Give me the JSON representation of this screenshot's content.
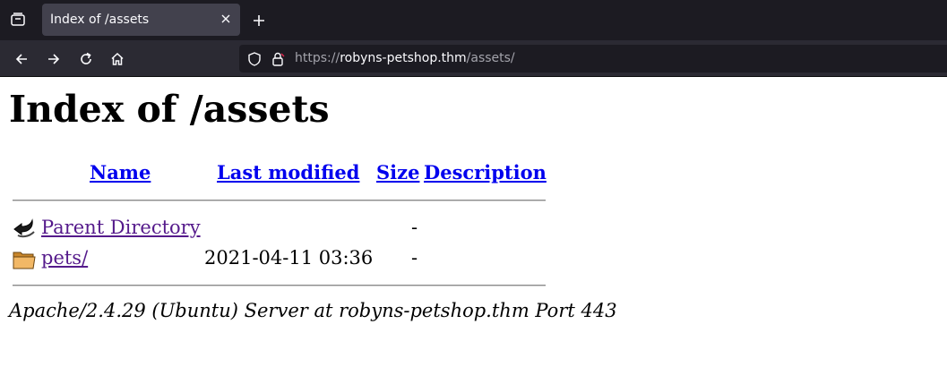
{
  "browser": {
    "tab": {
      "title": "Index of /assets"
    },
    "url": {
      "scheme": "https://",
      "host": "robyns-petshop.thm",
      "path": "/assets/"
    }
  },
  "page": {
    "heading": "Index of /assets",
    "columns": [
      "Name",
      "Last modified",
      "Size",
      "Description"
    ],
    "rows": [
      {
        "icon": "back-arrow-icon",
        "name": "Parent Directory",
        "modified": "",
        "size": "-",
        "description": ""
      },
      {
        "icon": "folder-icon",
        "name": "pets/",
        "modified": "2021-04-11 03:36",
        "size": "-",
        "description": ""
      }
    ],
    "footer": "Apache/2.4.29 (Ubuntu) Server at robyns-petshop.thm Port 443"
  }
}
